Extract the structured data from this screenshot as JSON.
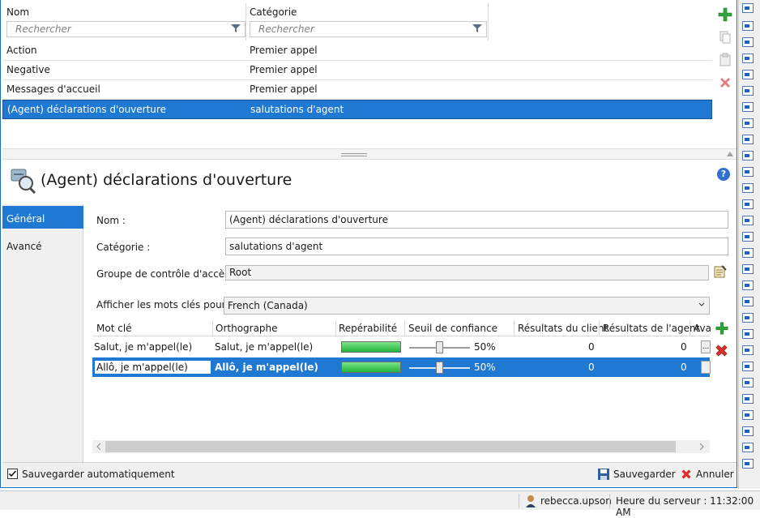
{
  "list": {
    "col_name": "Nom",
    "col_category": "Catégorie",
    "search_placeholder_name": "Rechercher",
    "search_placeholder_category": "Rechercher",
    "rows": [
      {
        "name": "Action",
        "category": "Premier appel"
      },
      {
        "name": "Negative",
        "category": "Premier appel"
      },
      {
        "name": "Messages d'accueil",
        "category": "Premier appel"
      },
      {
        "name": "(Agent) déclarations d'ouverture",
        "category": "salutations d'agent"
      }
    ]
  },
  "detail": {
    "title": "(Agent) déclarations d'ouverture",
    "help": "?",
    "nav": [
      "Général",
      "Avancé"
    ],
    "name_label": "Nom :",
    "name_value": "(Agent) déclarations d'ouverture",
    "category_label": "Catégorie :",
    "category_value": "salutations d'agent",
    "access_label": "Groupe de contrôle d'accès :",
    "access_value": "Root",
    "keywords_for_label": "Afficher les mots clés pour :",
    "keywords_for_value": "French (Canada)"
  },
  "grid": {
    "headers": [
      "Mot clé",
      "Orthographe",
      "Repérabilité",
      "Seuil de confiance",
      "Résultats du client",
      "Résultats de l'agent",
      "Ava"
    ],
    "rows": [
      {
        "keyword": "Salut, je m'appel(le)",
        "spelling": "Salut, je m'appel(le)",
        "detectability": 1.0,
        "confidence": "50%",
        "client": "0",
        "agent": "0",
        "more": "..."
      },
      {
        "keyword": "Allô, je m'appel(le)",
        "spelling": "Allô, je m'appel(le)",
        "detectability": 1.0,
        "confidence": "50%",
        "client": "0",
        "agent": "0",
        "more": "..."
      }
    ]
  },
  "footer": {
    "autosave": "Sauvegarder automatiquement",
    "save": "Sauvegarder",
    "cancel": "Annuler"
  },
  "status": {
    "user": "rebecca.upson",
    "server_time": "Heure du serveur : 11:32:00 AM"
  },
  "colors": {
    "selection": "#1f78d1",
    "add": "#2ea43a",
    "delete": "#d9302b"
  }
}
